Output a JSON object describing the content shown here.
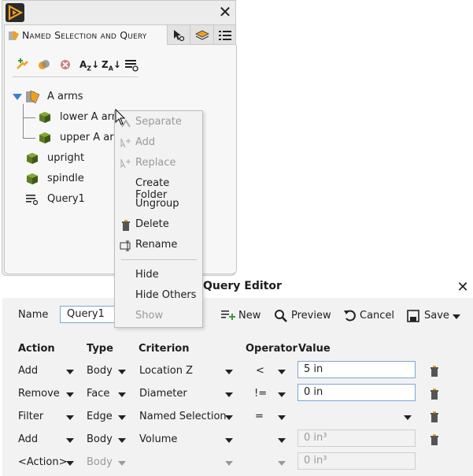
{
  "top_panel": {
    "tab_label": "Named Selection and Query",
    "tree": [
      {
        "label": "A arms",
        "icon": "folder-named-selection-icon"
      },
      {
        "label": "lower A arm",
        "icon": "green-cube-icon"
      },
      {
        "label": "upper A arm",
        "icon": "green-cube-icon"
      },
      {
        "label": "upright",
        "icon": "green-cube-icon"
      },
      {
        "label": "spindle",
        "icon": "green-cube-icon"
      },
      {
        "label": "Query1",
        "icon": "query-icon"
      }
    ]
  },
  "context_menu": {
    "items": [
      {
        "label": "Separate",
        "enabled": false
      },
      {
        "label": "Add",
        "enabled": false
      },
      {
        "label": "Replace",
        "enabled": false
      },
      {
        "label": "Create Folder",
        "enabled": true
      },
      {
        "label": "Ungroup",
        "enabled": true
      },
      {
        "label": "Delete",
        "enabled": true
      },
      {
        "label": "Rename",
        "enabled": true
      },
      {
        "label": "Hide",
        "enabled": true
      },
      {
        "label": "Hide Others",
        "enabled": true
      },
      {
        "label": "Show",
        "enabled": false
      }
    ]
  },
  "query_editor": {
    "title": "Query Editor",
    "name_label": "Name",
    "name_value": "Query1",
    "new_label": "New",
    "preview_label": "Preview",
    "cancel_label": "Cancel",
    "save_label": "Save",
    "headers": {
      "action": "Action",
      "type": "Type",
      "criterion": "Criterion",
      "operator": "Operator",
      "value": "Value"
    },
    "rows": [
      {
        "action": "Add",
        "type": "Body",
        "criterion": "Location Z",
        "operator": "<",
        "value": "5 in"
      },
      {
        "action": "Remove",
        "type": "Face",
        "criterion": "Diameter",
        "operator": "!=",
        "value": "0 in"
      },
      {
        "action": "Filter",
        "type": "Edge",
        "criterion": "Named Selection",
        "operator": "=",
        "value": ""
      },
      {
        "action": "Add",
        "type": "Body",
        "criterion": "Volume",
        "operator": "",
        "value": "0 in³"
      },
      {
        "action": "<Action>",
        "type": "Body",
        "criterion": "",
        "operator": "",
        "value": "0 in³"
      }
    ]
  },
  "colors": {
    "accent_blue": "#3a7fd0",
    "cube_green": "#6a8f2a",
    "logo_orange": "#f0a020"
  }
}
